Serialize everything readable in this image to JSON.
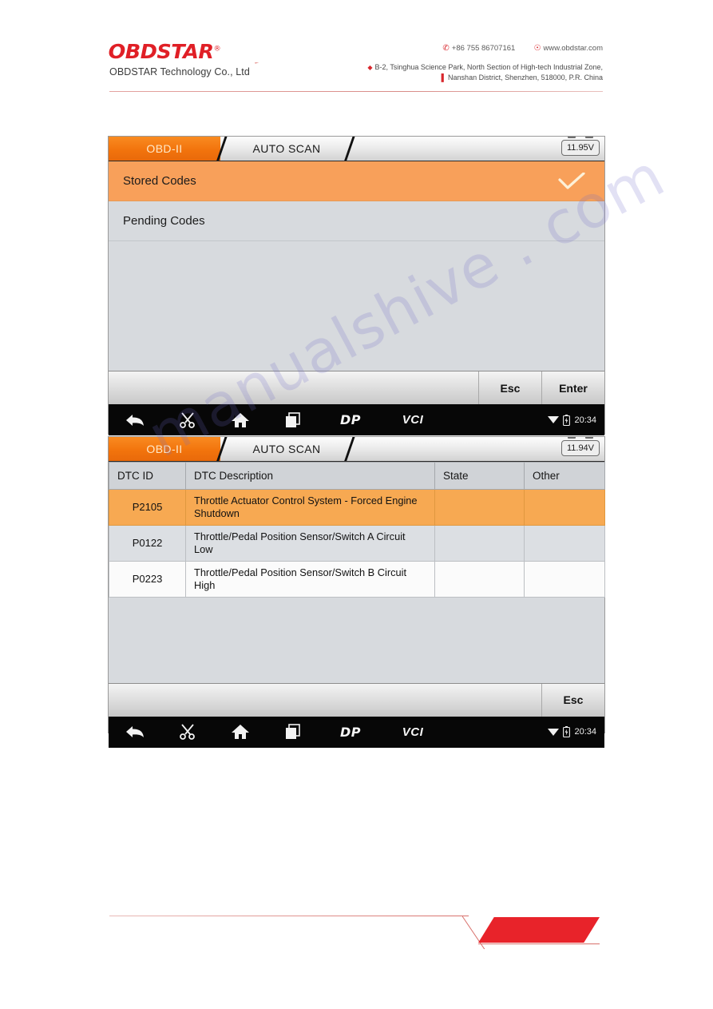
{
  "header": {
    "logo_text": "OBDSTAR",
    "logo_reg": "®",
    "company": "OBDSTAR Technology Co., Ltd",
    "phone_icon": "phone-icon",
    "phone": "+86 755 86707161",
    "web_icon": "globe-icon",
    "website": "www.obdstar.com",
    "address_line1": "B-2, Tsinghua Science Park, North Section of High-tech Industrial Zone,",
    "address_line2": "Nanshan District, Shenzhen, 518000, P.R.   China"
  },
  "screen1": {
    "tabs": {
      "active_label": "OBD-II",
      "plain_label": "AUTO SCAN"
    },
    "voltage": "11.95V",
    "menu_items": [
      {
        "label": "Stored Codes",
        "selected": true,
        "check_icon": "check-icon"
      },
      {
        "label": "Pending Codes",
        "selected": false,
        "check_icon": ""
      }
    ],
    "buttons": [
      {
        "label": "Esc"
      },
      {
        "label": "Enter"
      }
    ],
    "navbar": {
      "icons": [
        "back-arrow-icon",
        "scissors-icon",
        "home-icon",
        "recent-apps-icon"
      ],
      "brand_dp": "DP",
      "brand_vci": "VCI",
      "wifi_icon": "wifi-icon",
      "battery_icon": "battery-charging-icon",
      "time": "20:34"
    }
  },
  "screen2": {
    "tabs": {
      "active_label": "OBD-II",
      "plain_label": "AUTO SCAN"
    },
    "voltage": "11.94V",
    "table": {
      "columns": [
        "DTC ID",
        "DTC Description",
        "State",
        "Other"
      ],
      "rows": [
        {
          "dtc_id": "P2105",
          "description": "Throttle Actuator Control System - Forced Engine Shutdown",
          "state": "",
          "other": "",
          "highlight": "orange"
        },
        {
          "dtc_id": "P0122",
          "description": "Throttle/Pedal Position Sensor/Switch A Circuit Low",
          "state": "",
          "other": "",
          "highlight": "gray"
        },
        {
          "dtc_id": "P0223",
          "description": "Throttle/Pedal Position Sensor/Switch B Circuit High",
          "state": "",
          "other": "",
          "highlight": "white"
        }
      ]
    },
    "buttons": [
      {
        "label": "Esc"
      }
    ],
    "navbar": {
      "icons": [
        "back-arrow-icon",
        "scissors-icon",
        "home-icon",
        "recent-apps-icon"
      ],
      "brand_dp": "DP",
      "brand_vci": "VCI",
      "wifi_icon": "wifi-icon",
      "battery_icon": "battery-charging-icon",
      "time": "20:34"
    }
  },
  "watermark": {
    "text": "manualshive . com"
  },
  "colors": {
    "brand_red": "#e01f26",
    "tab_orange": "#f2740d",
    "row_orange": "#f7a952",
    "panel_gray": "#d7dade"
  }
}
